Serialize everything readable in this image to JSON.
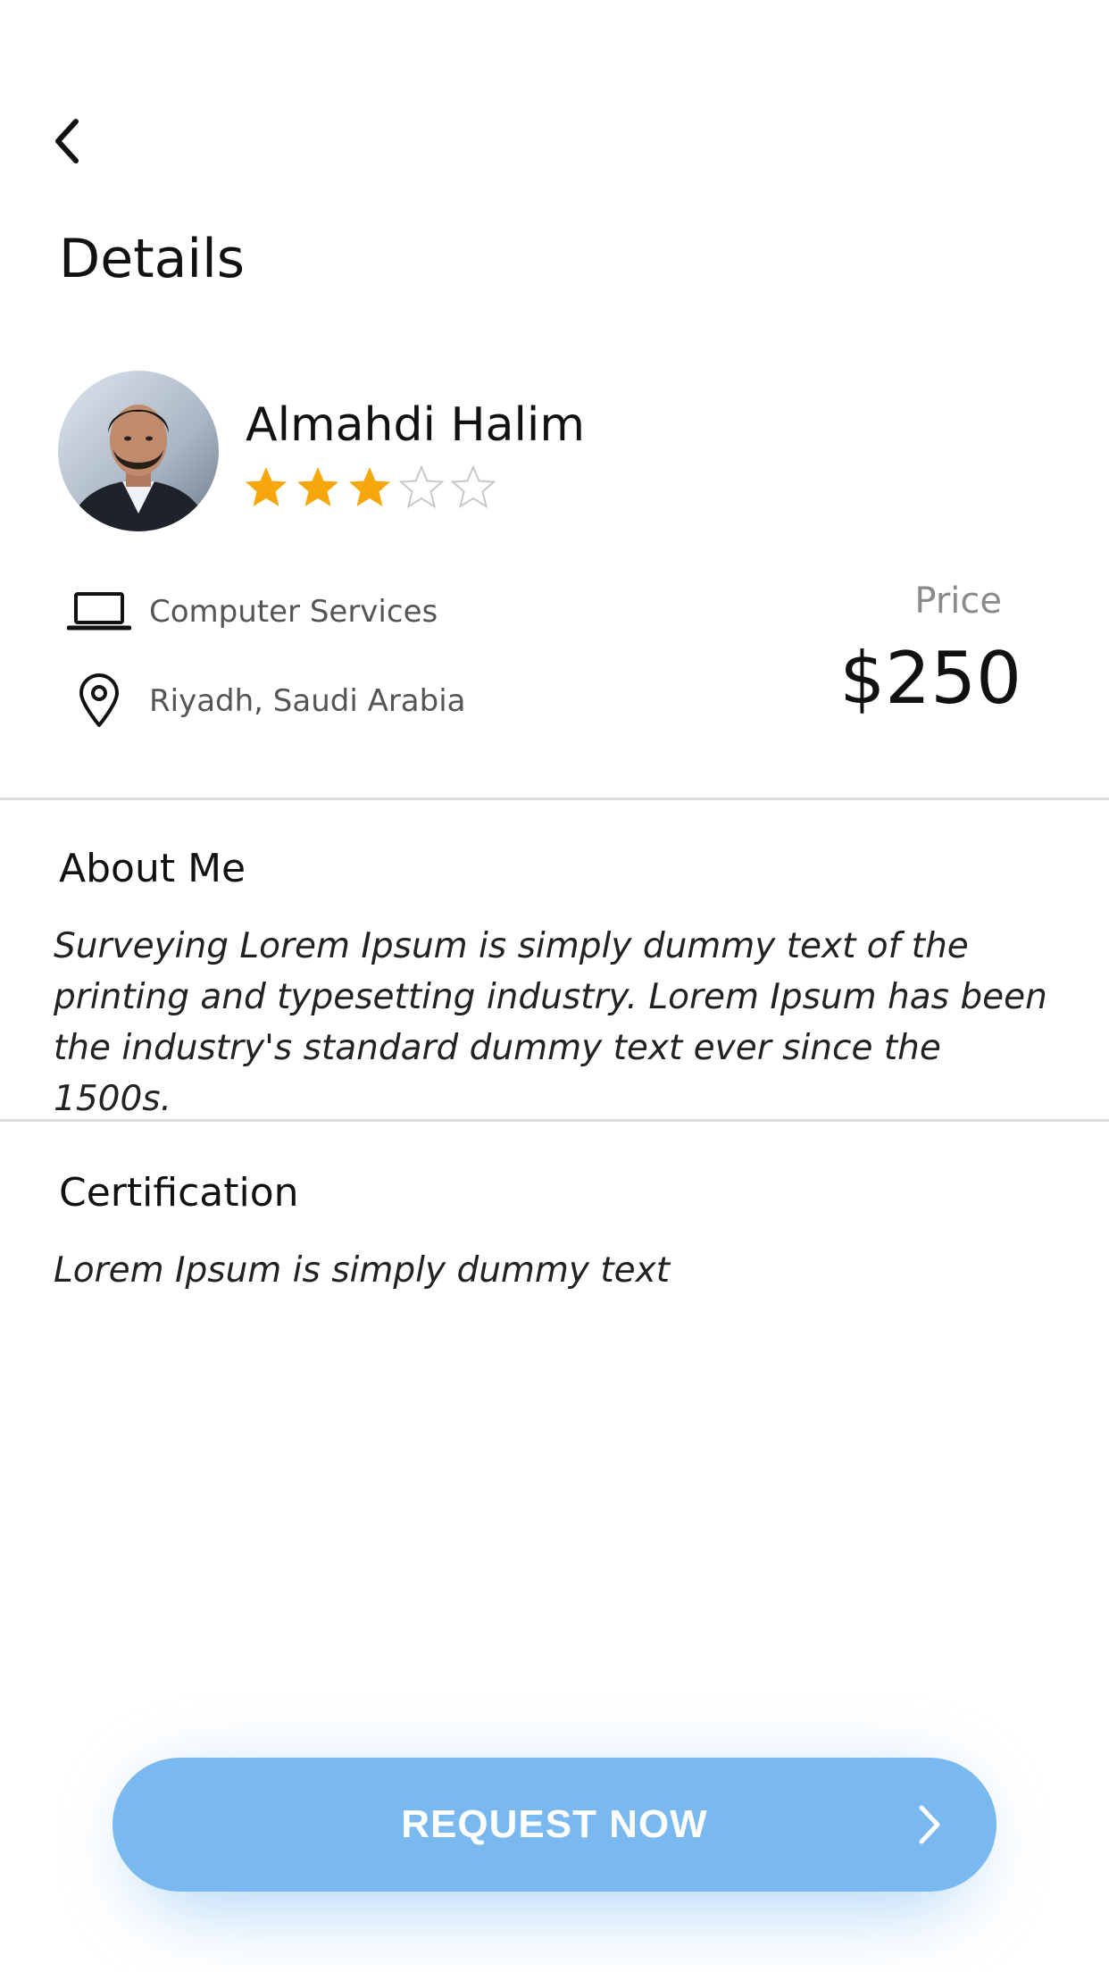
{
  "header": {
    "back_icon": "chevron-left-icon",
    "title": "Details"
  },
  "profile": {
    "name": "Almahdi Halim",
    "rating": 3,
    "rating_max": 5,
    "star_color": "#f5a70b",
    "star_empty_color": "#c8c8c8",
    "service_icon": "laptop-icon",
    "service": "Computer Services",
    "location_icon": "location-pin-icon",
    "location": "Riyadh, Saudi Arabia"
  },
  "price": {
    "label": "Price",
    "value": "$250"
  },
  "about": {
    "title": "About Me",
    "text": "Surveying Lorem Ipsum is simply dummy text of the printing and typesetting industry. Lorem Ipsum has been the industry's standard dummy text ever since the 1500s."
  },
  "certification": {
    "title": "Certification",
    "text": "Lorem Ipsum is simply dummy text"
  },
  "cta": {
    "label": "REQUEST NOW",
    "arrow_icon": "chevron-right-icon",
    "color": "#7ab9f0"
  }
}
